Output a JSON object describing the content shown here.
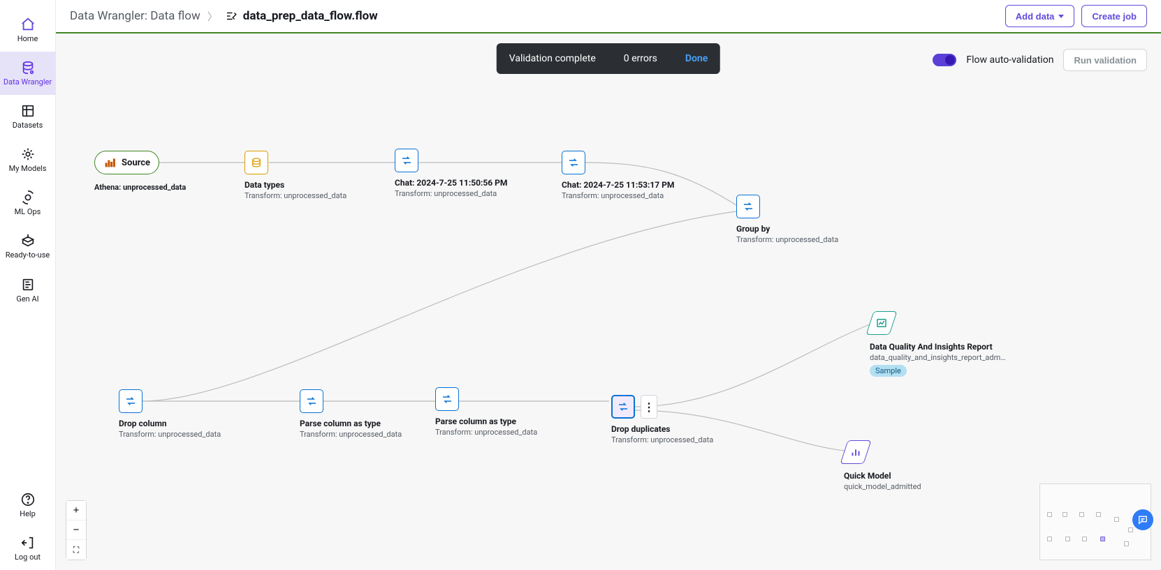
{
  "sidebar": {
    "items": [
      {
        "label": "Home"
      },
      {
        "label": "Data Wrangler"
      },
      {
        "label": "Datasets"
      },
      {
        "label": "My Models"
      },
      {
        "label": "ML Ops"
      },
      {
        "label": "Ready-to-use"
      },
      {
        "label": "Gen AI"
      },
      {
        "label": "Help"
      },
      {
        "label": "Log out"
      }
    ]
  },
  "header": {
    "root": "Data Wrangler: Data flow",
    "current": "data_prep_data_flow.flow",
    "add_data_label": "Add data",
    "create_job_label": "Create job"
  },
  "toast": {
    "title": "Validation complete",
    "errors": "0 errors",
    "done": "Done"
  },
  "top_right": {
    "flow_auto_validation": "Flow auto-validation",
    "run_validation": "Run validation"
  },
  "nodes": {
    "source": {
      "title": "Source",
      "sub": "Athena: unprocessed_data"
    },
    "datatypes": {
      "title": "Data types",
      "sub": "Transform: unprocessed_data"
    },
    "chat1": {
      "title": "Chat: 2024-7-25 11:50:56 PM",
      "sub": "Transform: unprocessed_data"
    },
    "chat2": {
      "title": "Chat: 2024-7-25 11:53:17 PM",
      "sub": "Transform: unprocessed_data"
    },
    "groupby": {
      "title": "Group by",
      "sub": "Transform: unprocessed_data"
    },
    "dropcol": {
      "title": "Drop column",
      "sub": "Transform: unprocessed_data"
    },
    "parse1": {
      "title": "Parse column as type",
      "sub": "Transform: unprocessed_data"
    },
    "parse2": {
      "title": "Parse column as type",
      "sub": "Transform: unprocessed_data"
    },
    "dropdup": {
      "title": "Drop duplicates",
      "sub": "Transform: unprocessed_data"
    },
    "report": {
      "title": "Data Quality And Insights Report",
      "sub": "data_quality_and_insights_report_adm…",
      "badge": "Sample"
    },
    "quickmodel": {
      "title": "Quick Model",
      "sub": "quick_model_admitted"
    }
  }
}
